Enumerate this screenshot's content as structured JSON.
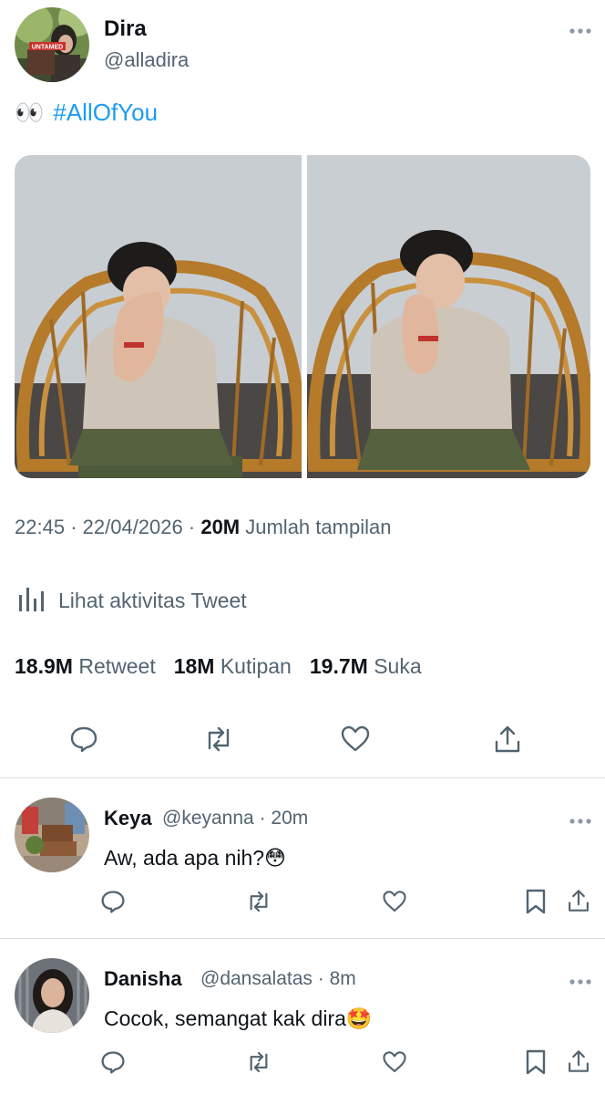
{
  "tweet": {
    "author_name": "Dira",
    "author_handle": "@alladira",
    "avatar_badge_text": "UNTAMED",
    "text_emoji": "👀",
    "hashtag": "#AllOfYou",
    "time": "22:45",
    "date": "22/04/2026",
    "views_count": "20M",
    "views_label": "Jumlah tampilan",
    "activity_label": "Lihat aktivitas Tweet",
    "stats": {
      "retweets_count": "18.9M",
      "retweets_label": "Retweet",
      "quotes_count": "18M",
      "quotes_label": "Kutipan",
      "likes_count": "19.7M",
      "likes_label": "Suka"
    }
  },
  "replies": [
    {
      "name": "Keya",
      "handle": "@keyanna",
      "time": "20m",
      "text": "Aw, ada apa nih?😳"
    },
    {
      "name": "Danisha",
      "handle": "@dansalatas",
      "time": "8m",
      "text": "Cocok, semangat kak dira🤩"
    }
  ],
  "icons": {
    "reply": "speech-bubble-icon",
    "retweet": "retweet-arrows-icon",
    "like": "heart-icon",
    "share": "share-upload-icon",
    "bookmark": "bookmark-icon",
    "more": "more-dots-icon",
    "analytics": "bar-chart-icon"
  },
  "colors": {
    "link": "#1d9bf0",
    "secondary_text": "#536471",
    "primary_text": "#0f1419",
    "divider": "#d9dfe3"
  }
}
